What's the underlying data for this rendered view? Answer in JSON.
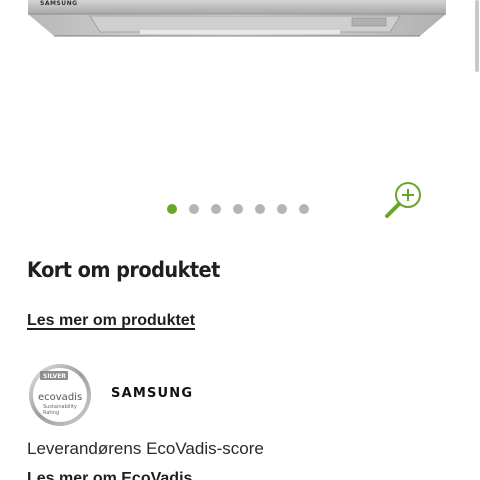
{
  "product_image": {
    "brand_text": "SAMSUNG"
  },
  "carousel": {
    "dot_count": 7,
    "active_index": 0,
    "active_color": "#6aa52a",
    "inactive_color": "#b4b4b4"
  },
  "section": {
    "title": "Kort om produktet",
    "read_more_link": "Les mer om produktet"
  },
  "ecovadis": {
    "badge_level": "SILVER",
    "badge_brand": "ecovadis",
    "badge_caption_1": "Sustainability",
    "badge_caption_2": "Rating",
    "supplier_logo": "SAMSUNG",
    "score_label": "Leverandørens EcoVadis-score",
    "read_more_link": "Les mer om EcoVadis"
  }
}
